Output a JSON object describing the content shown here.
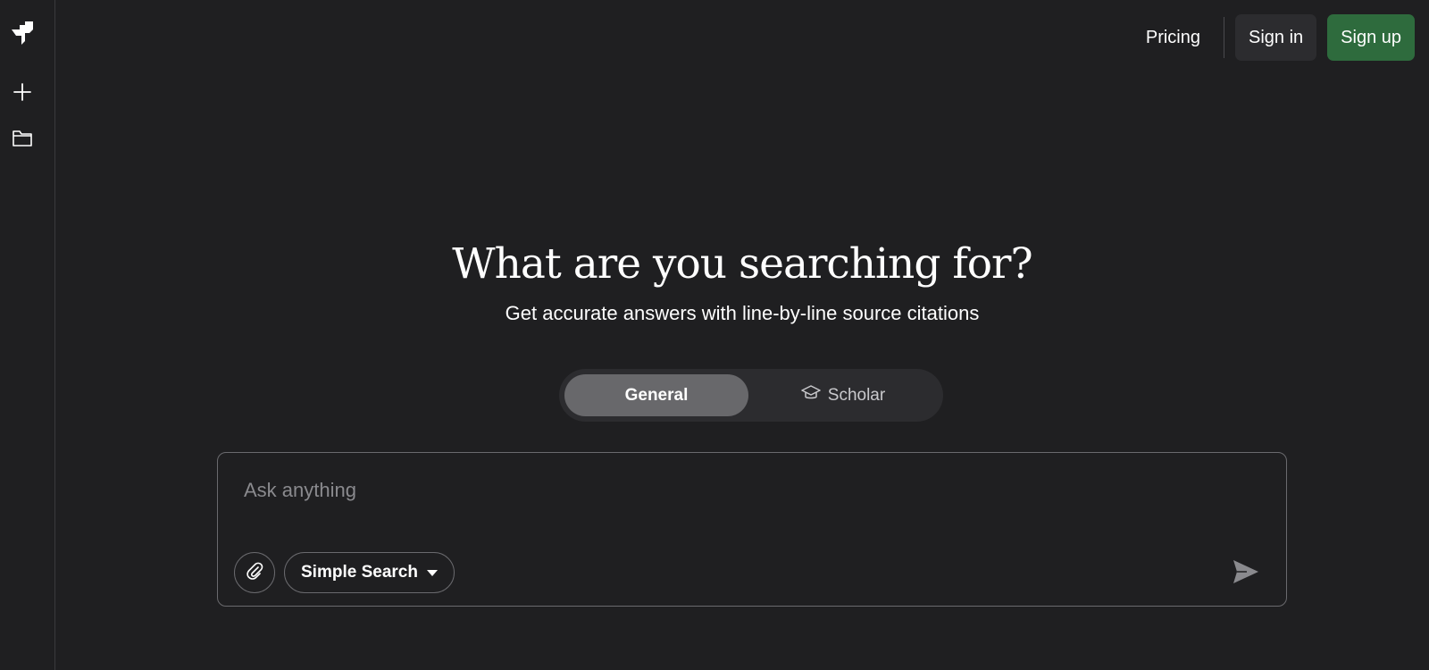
{
  "sidebar": {
    "logo_icon": "logo-icon",
    "new_icon": "plus-icon",
    "library_icon": "folder-icon"
  },
  "nav": {
    "pricing": "Pricing",
    "sign_in": "Sign in",
    "sign_up": "Sign up"
  },
  "hero": {
    "title": "What are you searching for?",
    "subtitle": "Get accurate answers with line-by-line source citations"
  },
  "modes": {
    "general": "General",
    "scholar": "Scholar",
    "active": "General"
  },
  "search": {
    "placeholder": "Ask anything",
    "value": "",
    "search_mode": "Simple Search"
  },
  "colors": {
    "background": "#1f1f21",
    "accent": "#2e6b3d",
    "surface": "#2c2c2f",
    "active_toggle": "#68686b"
  }
}
